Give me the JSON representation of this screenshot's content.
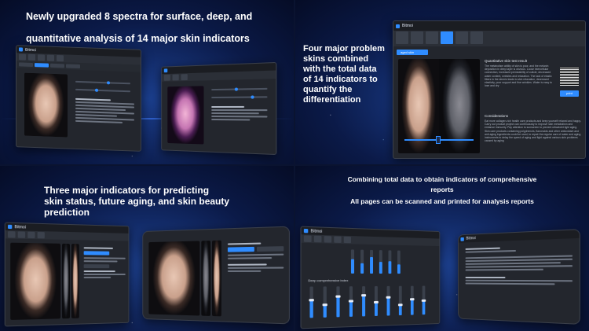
{
  "app": {
    "name": "Bitmoi"
  },
  "panel_tl": {
    "line1": "Newly upgraded 8 spectra for surface, deep, and",
    "line2": "quantitative analysis of 14 major skin indicators"
  },
  "panel_tr": {
    "heading_lines": [
      "Four major problem",
      "skins combined",
      "with the total data",
      "of 14 indicators to",
      "quantify the",
      "differentiation"
    ],
    "tab_label": "aged skin",
    "section1_title": "Quantitative skin test result",
    "section1_text": "The metabolism ability of skin is poor, and the melanin deposition in deep layer is obvious. Loose intercellular connection, increased permeability of cuticle, decreased water content, wrinkles and relaxation. The lack of elastic fibers in the dermis leads to skin relaxation, decreased elasticity, poor support and fine wrinkles. Water is easy to lose and dry",
    "section2_title": "Considerations",
    "section2_text": "Eat more collagen-rich health care products and keep yourself relaxed and happy. Carry out product project can continuously to improve skin metabolism and enhance immunity. Pay attention to sunscreen to prevent ultraviolet light aging. Skin care products containing polyphenols, flavonoids and other antioxidant and anti-aging ingredients could be used, to repair the regular care of water and aging instruments to delay the speed of aging and fight against various skin problems caused by aging",
    "print_label": "print"
  },
  "panel_bl": {
    "heading_lines": [
      "Three major indicators for predicting",
      "skin status, future aging, and skin beauty",
      "prediction"
    ]
  },
  "panel_br": {
    "line1": "Combining total data to obtain indicators of comprehensive",
    "line2": "reports",
    "line3": "All pages can be scanned and printed for analysis reports",
    "comprehensive_label": "Deep comprehensive index"
  },
  "colors": {
    "accent": "#2f8cff",
    "background": "#0b1a48",
    "window": "#23262d"
  }
}
